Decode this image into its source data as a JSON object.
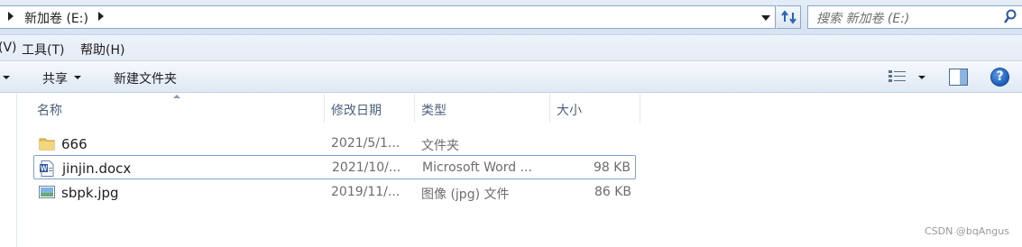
{
  "address_bar": {
    "breadcrumb": "新加卷 (E:)",
    "search_placeholder": "搜索 新加卷 (E:)"
  },
  "menu": {
    "items": [
      "(V)",
      "工具(T)",
      "帮助(H)"
    ]
  },
  "toolbar": {
    "share_label": "共享",
    "new_folder_label": "新建文件夹"
  },
  "columns": {
    "name": "名称",
    "modified": "修改日期",
    "type": "类型",
    "size": "大小"
  },
  "files": [
    {
      "name": "666",
      "modified": "2021/5/1...",
      "type": "文件夹",
      "size": "",
      "icon": "folder-icon"
    },
    {
      "name": "jinjin.docx",
      "modified": "2021/10/...",
      "type": "Microsoft Word ...",
      "size": "98 KB",
      "icon": "word-document-icon"
    },
    {
      "name": "sbpk.jpg",
      "modified": "2019/11/...",
      "type": "图像 (jpg) 文件",
      "size": "86 KB",
      "icon": "image-file-icon"
    }
  ],
  "watermark": "CSDN @bqAngus"
}
